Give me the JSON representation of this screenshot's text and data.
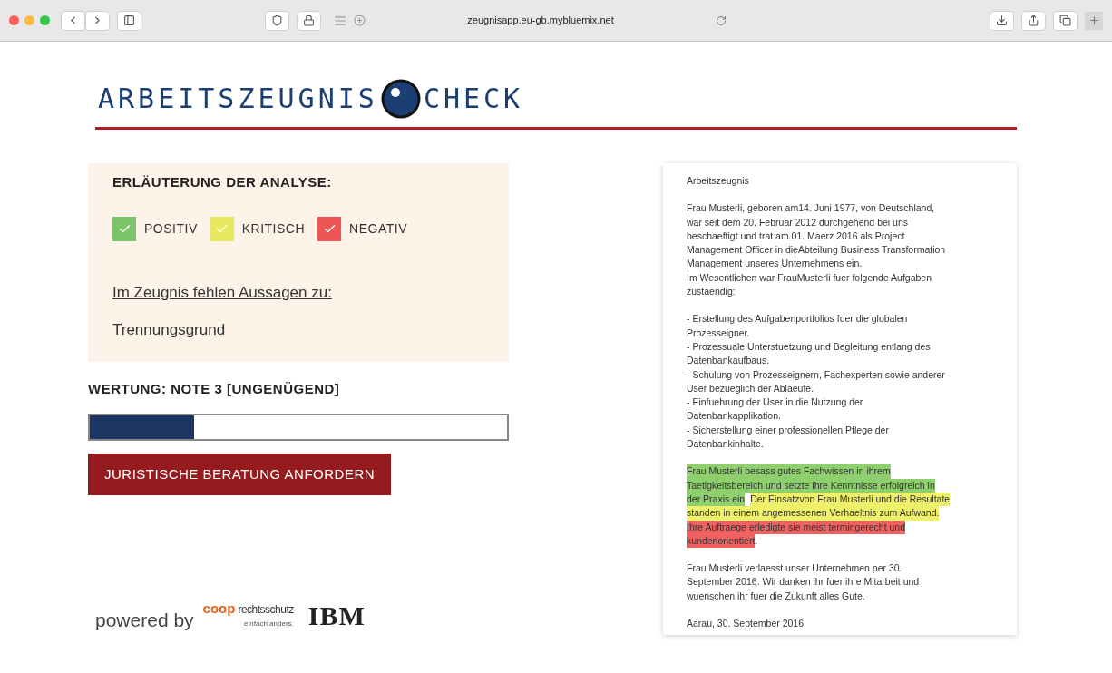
{
  "browser": {
    "url": "zeugnisapp.eu-gb.mybluemix.net"
  },
  "logo": {
    "left": "ARBEITSZEUGNIS",
    "right": "CHECK"
  },
  "legend": {
    "title": "ERLÄUTERUNG DER ANALYSE:",
    "items": [
      {
        "label": "POSITIV",
        "color": "#7cc46a"
      },
      {
        "label": "KRITISCH",
        "color": "#e6e85e"
      },
      {
        "label": "NEGATIV",
        "color": "#ee5656"
      }
    ],
    "missing_heading": "Im Zeugnis fehlen Aussagen zu:",
    "missing_items": [
      "Trennungsgrund"
    ]
  },
  "rating": {
    "label": "WERTUNG: NOTE 3 [UNGENÜGEND]",
    "level": 0.25
  },
  "action_button": "JURISTISCHE BERATUNG ANFORDERN",
  "footer": {
    "powered_by": "powered by",
    "coop": "coop",
    "rechtsschutz": "rechtsschutz",
    "slogan": "einfach anders.",
    "ibm": "IBM"
  },
  "document": {
    "blocks": [
      {
        "lines": [
          [
            {
              "text": "Arbeitszeugnis"
            }
          ]
        ]
      },
      {
        "lines": [
          [
            {
              "text": "Frau Musterli, geboren am14. Juni 1977, von Deutschland,"
            }
          ],
          [
            {
              "text": "war seit dem 20. Februar 2012 durchgehend bei uns"
            }
          ],
          [
            {
              "text": "beschaeftigt und trat am 01. Maerz 2016 als Project"
            }
          ],
          [
            {
              "text": "Management Officer in dieAbteilung Business Transformation"
            }
          ],
          [
            {
              "text": "Management unseres Unternehmens ein."
            }
          ],
          [
            {
              "text": "Im Wesentlichen war FrauMusterli fuer folgende Aufgaben"
            }
          ],
          [
            {
              "text": "zustaendig:"
            }
          ]
        ]
      },
      {
        "lines": [
          [
            {
              "text": "- Erstellung des Aufgabenportfolios fuer die globalen"
            }
          ],
          [
            {
              "text": "Prozesseigner."
            }
          ],
          [
            {
              "text": "- Prozessuale Unterstuetzung und Begleitung entlang des"
            }
          ],
          [
            {
              "text": "Datenbankaufbaus."
            }
          ],
          [
            {
              "text": "- Schulung von Prozesseignern, Fachexperten sowie anderer"
            }
          ],
          [
            {
              "text": "User bezueglich der Ablaeufe."
            }
          ],
          [
            {
              "text": "- Einfuehrung der User in die Nutzung der"
            }
          ],
          [
            {
              "text": "Datenbankapplikation."
            }
          ],
          [
            {
              "text": "- Sicherstellung einer professionellen Pflege der"
            }
          ],
          [
            {
              "text": "Datenbankinhalte."
            }
          ]
        ]
      },
      {
        "lines": [
          [
            {
              "text": "Frau Musterli besass gutes Fachwissen in ihrem",
              "color": "#8fd06e"
            }
          ],
          [
            {
              "text": "Taetigkeitsbereich und setzte ihre Kenntnisse erfolgreich in",
              "color": "#8fd06e"
            }
          ],
          [
            {
              "text": "der Praxis ein",
              "color": "#8fd06e"
            },
            {
              "text": "."
            },
            {
              "text": "Der Einsatzvon Frau Musterli und die Resultate",
              "color": "#eef06a"
            }
          ],
          [
            {
              "text": "standen in einem angemessenen Verhaeltnis zum Aufwand.",
              "color": "#eef06a"
            }
          ],
          [
            {
              "text": "Ihre Auftraege erledigte sie meist termingerecht und",
              "color": "#f06262"
            }
          ],
          [
            {
              "text": "kundenorientiert",
              "color": "#f06262"
            },
            {
              "text": "."
            }
          ]
        ]
      },
      {
        "lines": [
          [
            {
              "text": "Frau Musterli verlaesst unser Unternehmen per 30."
            }
          ],
          [
            {
              "text": "September 2016. Wir danken ihr fuer ihre Mitarbeit und"
            }
          ],
          [
            {
              "text": "wuenschen ihr fuer die Zukunft alles Gute."
            }
          ]
        ]
      },
      {
        "lines": [
          [
            {
              "text": "Aarau, 30. September 2016."
            }
          ]
        ]
      }
    ]
  }
}
